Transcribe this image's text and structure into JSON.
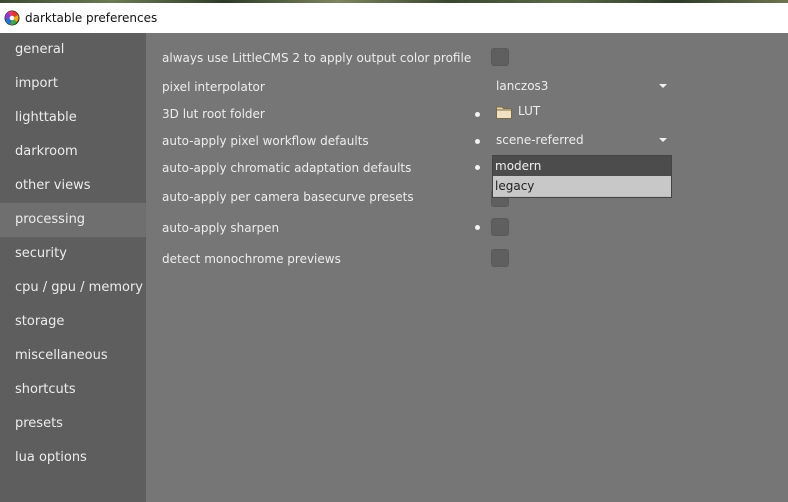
{
  "window": {
    "title": "darktable preferences"
  },
  "sidebar": {
    "items": [
      {
        "label": "general",
        "active": false
      },
      {
        "label": "import",
        "active": false
      },
      {
        "label": "lighttable",
        "active": false
      },
      {
        "label": "darkroom",
        "active": false
      },
      {
        "label": "other views",
        "active": false
      },
      {
        "label": "processing",
        "active": true
      },
      {
        "label": "security",
        "active": false
      },
      {
        "label": "cpu / gpu / memory",
        "active": false
      },
      {
        "label": "storage",
        "active": false
      },
      {
        "label": "miscellaneous",
        "active": false
      },
      {
        "label": "shortcuts",
        "active": false
      },
      {
        "label": "presets",
        "active": false
      },
      {
        "label": "lua options",
        "active": false
      }
    ]
  },
  "settings": {
    "lcms": {
      "label": "always use LittleCMS 2 to apply output color profile",
      "checked": false,
      "modified": false
    },
    "interpolator": {
      "label": "pixel interpolator",
      "value": "lanczos3",
      "modified": false
    },
    "lut_folder": {
      "label": "3D lut root folder",
      "value": "LUT",
      "modified": true
    },
    "pixel_workflow": {
      "label": "auto-apply pixel workflow defaults",
      "value": "scene-referred",
      "modified": true
    },
    "chromatic": {
      "label": "auto-apply chromatic adaptation defaults",
      "modified": true
    },
    "basecurve": {
      "label": "auto-apply per camera basecurve presets",
      "checked": false,
      "modified": false
    },
    "sharpen": {
      "label": "auto-apply sharpen",
      "checked": false,
      "modified": true
    },
    "monochrome": {
      "label": "detect monochrome previews",
      "checked": false,
      "modified": false
    }
  },
  "dropdown": {
    "options": [
      "modern",
      "legacy"
    ],
    "highlighted": "modern"
  },
  "colors": {
    "sidebar_bg": "#5e5e5e",
    "sidebar_active": "#6f6f6f",
    "main_bg": "#767676",
    "dropdown_bg": "#c8c8c8",
    "dropdown_highlight": "#4c4c4c"
  },
  "icons": {
    "app": "darktable-logo-icon",
    "folder": "folder-icon",
    "combo": "chevron-down-icon"
  }
}
